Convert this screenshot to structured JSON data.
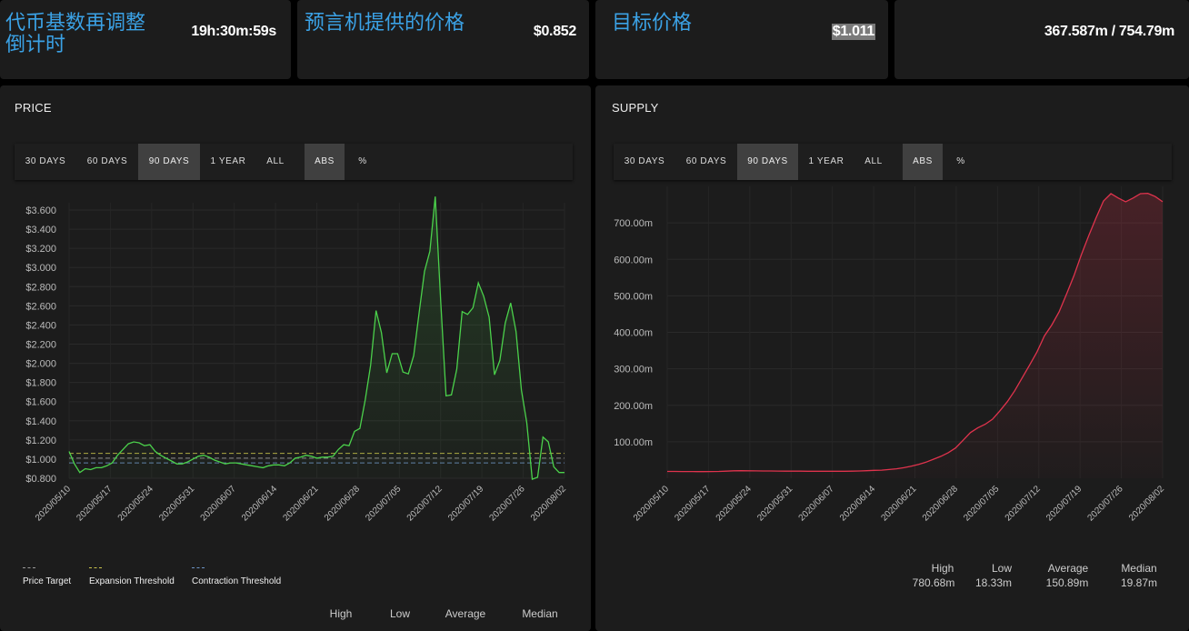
{
  "stats": {
    "rebase_countdown": {
      "label": "代币基数再调整\n倒计时",
      "value": "19h:30m:59s"
    },
    "oracle_price": {
      "label": "预言机提供的价格",
      "value": "$0.852"
    },
    "target_price": {
      "label": "目标价格",
      "value": "$1.011"
    },
    "supply_ratio": {
      "value": "367.587m / 754.79m"
    }
  },
  "price_panel": {
    "title": "PRICE",
    "ranges": [
      "30 DAYS",
      "60 DAYS",
      "90 DAYS",
      "1 YEAR",
      "ALL"
    ],
    "active_range": "90 DAYS",
    "modes": [
      "ABS",
      "%"
    ],
    "active_mode": "ABS",
    "legend": [
      {
        "label": "Price Target",
        "color": "#9a9a9a"
      },
      {
        "label": "Expansion Threshold",
        "color": "#c9c24a"
      },
      {
        "label": "Contraction Threshold",
        "color": "#6d93c4"
      }
    ],
    "summary_labels": [
      "High",
      "Low",
      "Average",
      "Median"
    ]
  },
  "supply_panel": {
    "title": "SUPPLY",
    "ranges": [
      "30 DAYS",
      "60 DAYS",
      "90 DAYS",
      "1 YEAR",
      "ALL"
    ],
    "active_range": "90 DAYS",
    "modes": [
      "ABS",
      "%"
    ],
    "active_mode": "ABS",
    "summary_labels": [
      "High",
      "Low",
      "Average",
      "Median"
    ],
    "summary_values": [
      "780.68m",
      "18.33m",
      "150.89m",
      "19.87m"
    ]
  },
  "chart_data": [
    {
      "type": "line",
      "name": "price",
      "x_ticks": [
        "2020/05/10",
        "2020/05/17",
        "2020/05/24",
        "2020/05/31",
        "2020/06/07",
        "2020/06/14",
        "2020/06/21",
        "2020/06/28",
        "2020/07/05",
        "2020/07/12",
        "2020/07/19",
        "2020/07/26",
        "2020/08/02"
      ],
      "y_ticks": [
        "$0.800",
        "$1.000",
        "$1.200",
        "$1.400",
        "$1.600",
        "$1.800",
        "$2.000",
        "$2.200",
        "$2.400",
        "$2.600",
        "$2.800",
        "$3.000",
        "$3.200",
        "$3.400",
        "$3.600"
      ],
      "ylim": [
        0.8,
        3.6
      ],
      "reference_lines": {
        "price_target": 1.01,
        "expansion_threshold": 1.06,
        "contraction_threshold": 0.96
      },
      "line_color": "#4bd14b",
      "series": [
        {
          "values": [
            1.08,
            0.95,
            0.86,
            0.9,
            0.89,
            0.91,
            0.91,
            0.93,
            0.96,
            1.04,
            1.1,
            1.16,
            1.18,
            1.17,
            1.14,
            1.15,
            1.08,
            1.04,
            1.01,
            0.98,
            0.95,
            0.95,
            0.97,
            1.0,
            1.03,
            1.04,
            1.02,
            0.99,
            0.97,
            0.95,
            0.96,
            0.96,
            0.95,
            0.94,
            0.93,
            0.92,
            0.91,
            0.93,
            0.94,
            0.94,
            0.93,
            0.96,
            1.01,
            1.02,
            1.04,
            1.03,
            1.01,
            1.02,
            1.02,
            1.03,
            1.1,
            1.15,
            1.14,
            1.29,
            1.32,
            1.62,
            1.98,
            2.55,
            2.32,
            1.9,
            2.1,
            2.1,
            1.91,
            1.89,
            2.08,
            2.53,
            2.96,
            3.17,
            3.74,
            2.65,
            1.66,
            1.67,
            1.94,
            2.54,
            2.51,
            2.58,
            2.84,
            2.7,
            2.48,
            1.88,
            2.03,
            2.42,
            2.63,
            2.33,
            1.72,
            1.38,
            0.79,
            0.81,
            1.23,
            1.18,
            0.92,
            0.86,
            0.86
          ]
        }
      ]
    },
    {
      "type": "area",
      "name": "supply",
      "x_ticks": [
        "2020/05/10",
        "2020/05/17",
        "2020/05/24",
        "2020/05/31",
        "2020/06/07",
        "2020/06/14",
        "2020/06/21",
        "2020/06/28",
        "2020/07/05",
        "2020/07/12",
        "2020/07/19",
        "2020/07/26",
        "2020/08/02"
      ],
      "y_ticks": [
        "100.00m",
        "200.00m",
        "300.00m",
        "400.00m",
        "500.00m",
        "600.00m",
        "700.00m"
      ],
      "ylim": [
        0,
        800
      ],
      "line_color": "#e0334d",
      "series": [
        {
          "values": [
            18.8,
            18.6,
            18.5,
            18.4,
            18.3,
            18.3,
            18.4,
            18.6,
            19.5,
            20.5,
            20.6,
            20.4,
            20.2,
            20.0,
            19.9,
            19.7,
            19.5,
            19.4,
            19.4,
            19.3,
            19.2,
            19.1,
            19.1,
            19.2,
            19.3,
            19.4,
            19.9,
            20.8,
            21.6,
            22.2,
            24,
            26,
            29,
            33,
            38,
            44,
            52,
            60,
            70,
            83,
            104,
            125,
            138,
            148,
            162,
            185,
            210,
            240,
            275,
            310,
            346,
            390,
            420,
            456,
            505,
            555,
            612,
            665,
            714,
            760,
            780,
            768,
            758,
            768,
            780,
            781,
            772,
            758
          ]
        }
      ]
    }
  ]
}
